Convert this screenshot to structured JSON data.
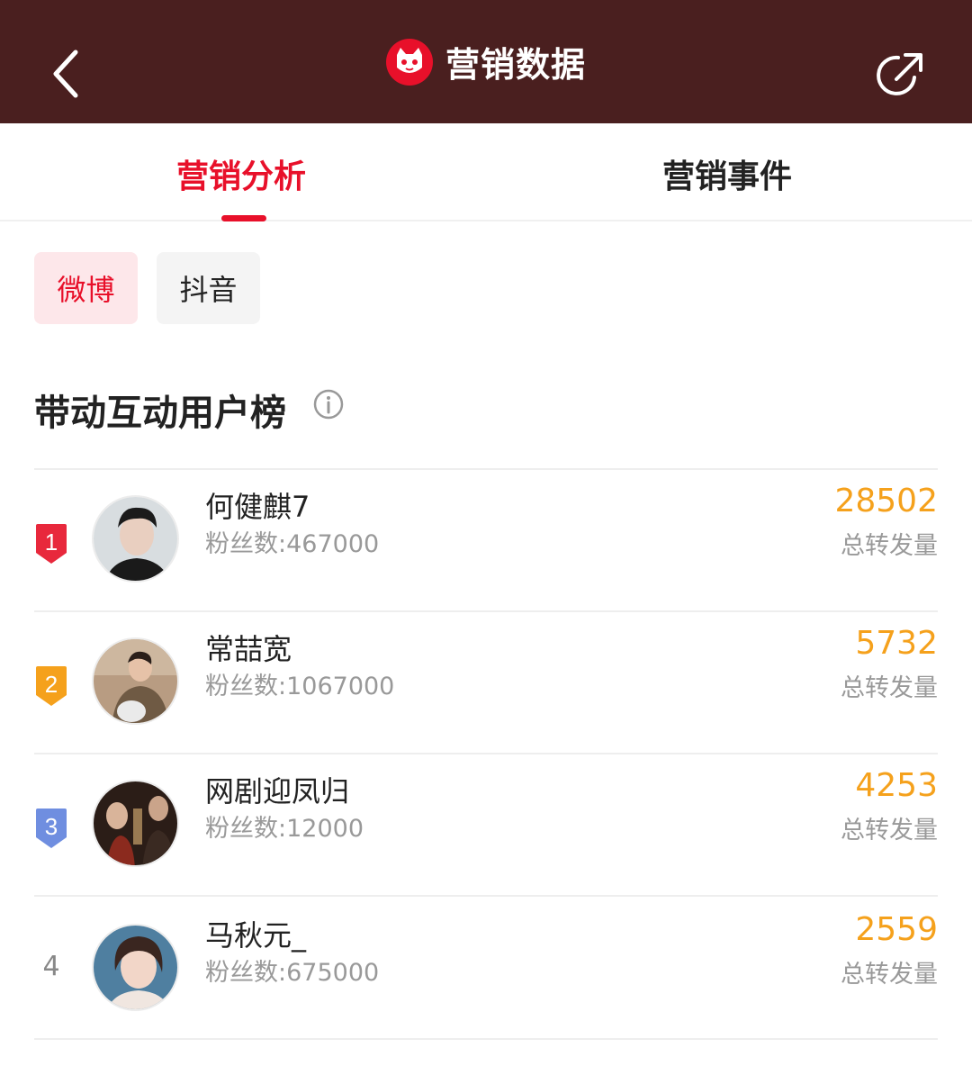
{
  "header": {
    "title": "营销数据",
    "back_icon": "chevron-left-icon",
    "logo_icon": "cat-logo-icon",
    "share_icon": "share-icon",
    "bg_color": "#4a1f1f"
  },
  "tabs": [
    {
      "label": "营销分析",
      "active": true
    },
    {
      "label": "营销事件",
      "active": false
    }
  ],
  "platform_chips": [
    {
      "label": "微博",
      "active": true
    },
    {
      "label": "抖音",
      "active": false
    }
  ],
  "section": {
    "title": "带动互动用户榜",
    "info_icon": "info-icon"
  },
  "ranking": [
    {
      "rank": "1",
      "name": "何健麒7",
      "fans_label": "粉丝数:",
      "fans": "467000",
      "metric": "28502",
      "metric_label": "总转发量",
      "badge_color": "#e8283c"
    },
    {
      "rank": "2",
      "name": "常喆宽",
      "fans_label": "粉丝数:",
      "fans": "1067000",
      "metric": "5732",
      "metric_label": "总转发量",
      "badge_color": "#f5a11c"
    },
    {
      "rank": "3",
      "name": "网剧迎凤归",
      "fans_label": "粉丝数:",
      "fans": "12000",
      "metric": "4253",
      "metric_label": "总转发量",
      "badge_color": "#6f8ee0"
    },
    {
      "rank": "4",
      "name": "马秋元_",
      "fans_label": "粉丝数:",
      "fans": "675000",
      "metric": "2559",
      "metric_label": "总转发量",
      "badge_color": ""
    }
  ],
  "colors": {
    "accent": "#e8102a",
    "metric": "#f5a11c"
  }
}
